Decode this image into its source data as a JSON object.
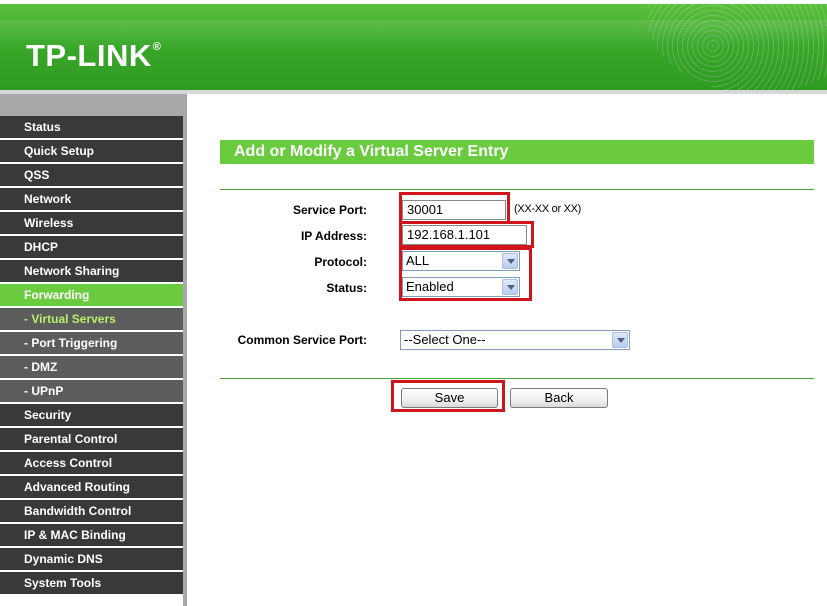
{
  "header": {
    "logo": "TP-LINK",
    "logo_mark": "®"
  },
  "sidebar": {
    "items": [
      {
        "label": "Status"
      },
      {
        "label": "Quick Setup"
      },
      {
        "label": "QSS"
      },
      {
        "label": "Network"
      },
      {
        "label": "Wireless"
      },
      {
        "label": "DHCP"
      },
      {
        "label": "Network Sharing"
      },
      {
        "label": "Forwarding"
      },
      {
        "label": "- Virtual Servers"
      },
      {
        "label": "- Port Triggering"
      },
      {
        "label": "- DMZ"
      },
      {
        "label": "- UPnP"
      },
      {
        "label": "Security"
      },
      {
        "label": "Parental Control"
      },
      {
        "label": "Access Control"
      },
      {
        "label": "Advanced Routing"
      },
      {
        "label": "Bandwidth Control"
      },
      {
        "label": "IP & MAC Binding"
      },
      {
        "label": "Dynamic DNS"
      },
      {
        "label": "System Tools"
      }
    ]
  },
  "form": {
    "title": "Add or Modify a Virtual Server Entry",
    "service_port": {
      "label": "Service Port:",
      "value": "30001",
      "hint": "(XX-XX or XX)"
    },
    "ip_address": {
      "label": "IP Address:",
      "value": "192.168.1.101"
    },
    "protocol": {
      "label": "Protocol:",
      "value": "ALL"
    },
    "status": {
      "label": "Status:",
      "value": "Enabled"
    },
    "common_service_port": {
      "label": "Common Service Port:",
      "value": "--Select One--"
    },
    "save_label": "Save",
    "back_label": "Back"
  },
  "colors": {
    "brand_green": "#6acb3e",
    "menu_dark": "#393939",
    "highlight_red": "#d0141d"
  }
}
